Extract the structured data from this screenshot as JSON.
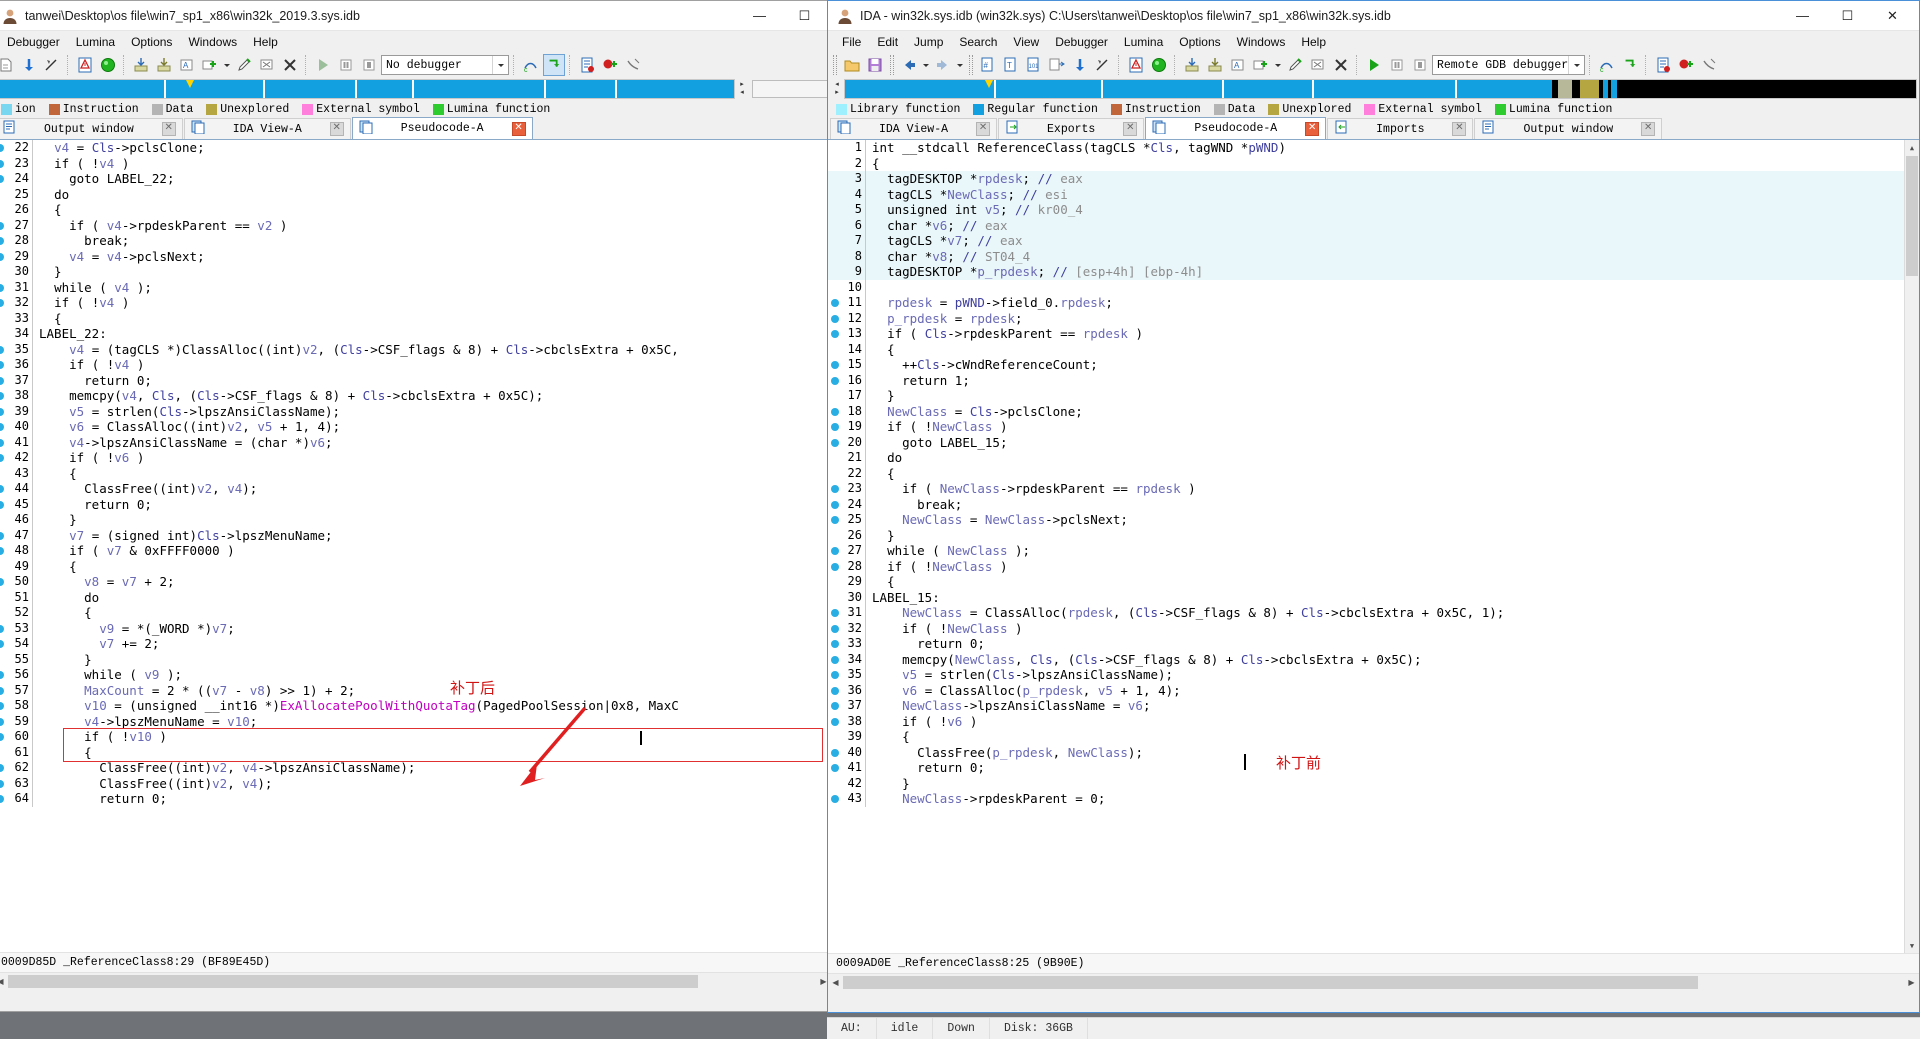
{
  "left_window": {
    "title": "tanwei\\Desktop\\os file\\win7_sp1_x86\\win32k_2019.3.sys.idb",
    "controls": {
      "minimize": "—",
      "maximize": "☐",
      "close": "✕"
    },
    "menu": [
      "Debugger",
      "Lumina",
      "Options",
      "Windows",
      "Help"
    ],
    "toolbar": {
      "debugger_combo": "No debugger"
    },
    "legend": [
      {
        "label": "ion",
        "color": "#7ad7f0"
      },
      {
        "label": "Instruction",
        "color": "#c1663a"
      },
      {
        "label": "Data",
        "color": "#b4b4b4"
      },
      {
        "label": "Unexplored",
        "color": "#b5a642"
      },
      {
        "label": "External symbol",
        "color": "#ff7fdc"
      },
      {
        "label": "Lumina function",
        "color": "#2ecc2e"
      }
    ],
    "tabs": [
      {
        "label": "Output window",
        "active": false
      },
      {
        "label": "IDA View-A",
        "active": false
      },
      {
        "label": "Pseudocode-A",
        "active": true
      }
    ],
    "annotation": "补丁后",
    "address_status": "0009D85D _ReferenceClass8:29 (BF89E45D)",
    "code": [
      {
        "n": "22",
        "bp": true,
        "indent": 1,
        "text": "v4 = Cls->pclsClone;"
      },
      {
        "n": "23",
        "bp": true,
        "indent": 1,
        "text": "if ( !v4 )"
      },
      {
        "n": "24",
        "bp": true,
        "indent": 2,
        "text": "goto LABEL_22;"
      },
      {
        "n": "25",
        "bp": false,
        "indent": 1,
        "text": "do"
      },
      {
        "n": "26",
        "bp": false,
        "indent": 1,
        "text": "{"
      },
      {
        "n": "27",
        "bp": true,
        "indent": 2,
        "text": "if ( v4->rpdeskParent == v2 )"
      },
      {
        "n": "28",
        "bp": true,
        "indent": 3,
        "text": "break;"
      },
      {
        "n": "29",
        "bp": true,
        "indent": 2,
        "text": "v4 = v4->pclsNext;"
      },
      {
        "n": "30",
        "bp": false,
        "indent": 1,
        "text": "}"
      },
      {
        "n": "31",
        "bp": true,
        "indent": 1,
        "text": "while ( v4 );"
      },
      {
        "n": "32",
        "bp": true,
        "indent": 1,
        "text": "if ( !v4 )"
      },
      {
        "n": "33",
        "bp": false,
        "indent": 1,
        "text": "{"
      },
      {
        "n": "34",
        "bp": false,
        "indent": 0,
        "text": "LABEL_22:"
      },
      {
        "n": "35",
        "bp": true,
        "indent": 2,
        "text": "v4 = (tagCLS *)ClassAlloc((int)v2, (Cls->CSF_flags & 8) + Cls->cbclsExtra + 0x5C,"
      },
      {
        "n": "36",
        "bp": true,
        "indent": 2,
        "text": "if ( !v4 )"
      },
      {
        "n": "37",
        "bp": true,
        "indent": 3,
        "text": "return 0;"
      },
      {
        "n": "38",
        "bp": true,
        "indent": 2,
        "text": "memcpy(v4, Cls, (Cls->CSF_flags & 8) + Cls->cbclsExtra + 0x5C);"
      },
      {
        "n": "39",
        "bp": true,
        "indent": 2,
        "text": "v5 = strlen(Cls->lpszAnsiClassName);"
      },
      {
        "n": "40",
        "bp": true,
        "indent": 2,
        "text": "v6 = ClassAlloc((int)v2, v5 + 1, 4);"
      },
      {
        "n": "41",
        "bp": true,
        "indent": 2,
        "text": "v4->lpszAnsiClassName = (char *)v6;"
      },
      {
        "n": "42",
        "bp": true,
        "indent": 2,
        "text": "if ( !v6 )"
      },
      {
        "n": "43",
        "bp": false,
        "indent": 2,
        "text": "{"
      },
      {
        "n": "44",
        "bp": true,
        "indent": 3,
        "text": "ClassFree((int)v2, v4);"
      },
      {
        "n": "45",
        "bp": true,
        "indent": 3,
        "text": "return 0;"
      },
      {
        "n": "46",
        "bp": false,
        "indent": 2,
        "text": "}"
      },
      {
        "n": "47",
        "bp": true,
        "indent": 2,
        "text": "v7 = (signed int)Cls->lpszMenuName;"
      },
      {
        "n": "48",
        "bp": true,
        "indent": 2,
        "text": "if ( v7 & 0xFFFF0000 )"
      },
      {
        "n": "49",
        "bp": false,
        "indent": 2,
        "text": "{"
      },
      {
        "n": "50",
        "bp": true,
        "indent": 3,
        "text": "v8 = v7 + 2;"
      },
      {
        "n": "51",
        "bp": false,
        "indent": 3,
        "text": "do"
      },
      {
        "n": "52",
        "bp": false,
        "indent": 3,
        "text": "{"
      },
      {
        "n": "53",
        "bp": true,
        "indent": 4,
        "text": "v9 = *(_WORD *)v7;"
      },
      {
        "n": "54",
        "bp": true,
        "indent": 4,
        "text": "v7 += 2;"
      },
      {
        "n": "55",
        "bp": false,
        "indent": 3,
        "text": "}"
      },
      {
        "n": "56",
        "bp": true,
        "indent": 3,
        "text": "while ( v9 );"
      },
      {
        "n": "57",
        "bp": true,
        "indent": 3,
        "text": "MaxCount = 2 * ((v7 - v8) >> 1) + 2;"
      },
      {
        "n": "58",
        "bp": true,
        "indent": 3,
        "text": "v10 = (unsigned __int16 *)ExAllocatePoolWithQuotaTag(PagedPoolSession|0x8, MaxC"
      },
      {
        "n": "59",
        "bp": true,
        "indent": 3,
        "text": "v4->lpszMenuName = v10;"
      },
      {
        "n": "60",
        "bp": true,
        "indent": 3,
        "text": "if ( !v10 )"
      },
      {
        "n": "61",
        "bp": false,
        "indent": 3,
        "text": "{"
      },
      {
        "n": "62",
        "bp": true,
        "indent": 4,
        "text": "ClassFree((int)v2, v4->lpszAnsiClassName);"
      },
      {
        "n": "63",
        "bp": true,
        "indent": 4,
        "text": "ClassFree((int)v2, v4);"
      },
      {
        "n": "64",
        "bp": true,
        "indent": 4,
        "text": "return 0;"
      }
    ]
  },
  "right_window": {
    "title": "IDA - win32k.sys.idb (win32k.sys) C:\\Users\\tanwei\\Desktop\\os file\\win7_sp1_x86\\win32k.sys.idb",
    "controls": {
      "minimize": "—",
      "maximize": "☐",
      "close": "✕"
    },
    "menu": [
      "File",
      "Edit",
      "Jump",
      "Search",
      "View",
      "Debugger",
      "Lumina",
      "Options",
      "Windows",
      "Help"
    ],
    "toolbar": {
      "debugger_combo": "Remote GDB debugger"
    },
    "legend": [
      {
        "label": "Library function",
        "color": "#9ff0ff"
      },
      {
        "label": "Regular function",
        "color": "#13a0e0"
      },
      {
        "label": "Instruction",
        "color": "#c1663a"
      },
      {
        "label": "Data",
        "color": "#b4b4b4"
      },
      {
        "label": "Unexplored",
        "color": "#b5a642"
      },
      {
        "label": "External symbol",
        "color": "#ff7fdc"
      },
      {
        "label": "Lumina function",
        "color": "#2ecc2e"
      }
    ],
    "tabs": [
      {
        "label": "IDA View-A",
        "active": false
      },
      {
        "label": "Exports",
        "active": false
      },
      {
        "label": "Pseudocode-A",
        "active": true
      },
      {
        "label": "Imports",
        "active": false
      },
      {
        "label": "Output window",
        "active": false
      }
    ],
    "annotation": "补丁前",
    "address_status": "0009AD0E _ReferenceClass8:25 (9B90E)",
    "statusbar": [
      "AU:",
      "idle",
      "Down",
      "Disk: 36GB"
    ],
    "code": [
      {
        "n": "1",
        "bp": false,
        "indent": 0,
        "hl": false,
        "text": "int __stdcall ReferenceClass(tagCLS *Cls, tagWND *pWND)"
      },
      {
        "n": "2",
        "bp": false,
        "indent": 0,
        "hl": false,
        "text": "{"
      },
      {
        "n": "3",
        "bp": false,
        "indent": 1,
        "hl": true,
        "text": "tagDESKTOP *rpdesk; // eax"
      },
      {
        "n": "4",
        "bp": false,
        "indent": 1,
        "hl": true,
        "text": "tagCLS *NewClass; // esi"
      },
      {
        "n": "5",
        "bp": false,
        "indent": 1,
        "hl": true,
        "text": "unsigned int v5; // kr00_4"
      },
      {
        "n": "6",
        "bp": false,
        "indent": 1,
        "hl": true,
        "text": "char *v6; // eax"
      },
      {
        "n": "7",
        "bp": false,
        "indent": 1,
        "hl": true,
        "text": "tagCLS *v7; // eax"
      },
      {
        "n": "8",
        "bp": false,
        "indent": 1,
        "hl": true,
        "text": "char *v8; // ST04_4"
      },
      {
        "n": "9",
        "bp": false,
        "indent": 1,
        "hl": true,
        "text": "tagDESKTOP *p_rpdesk; // [esp+4h] [ebp-4h]"
      },
      {
        "n": "10",
        "bp": false,
        "indent": 0,
        "hl": false,
        "text": ""
      },
      {
        "n": "11",
        "bp": true,
        "indent": 1,
        "hl": false,
        "text": "rpdesk = pWND->field_0.rpdesk;"
      },
      {
        "n": "12",
        "bp": true,
        "indent": 1,
        "hl": false,
        "text": "p_rpdesk = rpdesk;"
      },
      {
        "n": "13",
        "bp": true,
        "indent": 1,
        "hl": false,
        "text": "if ( Cls->rpdeskParent == rpdesk )"
      },
      {
        "n": "14",
        "bp": false,
        "indent": 1,
        "hl": false,
        "text": "{"
      },
      {
        "n": "15",
        "bp": true,
        "indent": 2,
        "hl": false,
        "text": "++Cls->cWndReferenceCount;"
      },
      {
        "n": "16",
        "bp": true,
        "indent": 2,
        "hl": false,
        "text": "return 1;"
      },
      {
        "n": "17",
        "bp": false,
        "indent": 1,
        "hl": false,
        "text": "}"
      },
      {
        "n": "18",
        "bp": true,
        "indent": 1,
        "hl": false,
        "text": "NewClass = Cls->pclsClone;"
      },
      {
        "n": "19",
        "bp": true,
        "indent": 1,
        "hl": false,
        "text": "if ( !NewClass )"
      },
      {
        "n": "20",
        "bp": true,
        "indent": 2,
        "hl": false,
        "text": "goto LABEL_15;"
      },
      {
        "n": "21",
        "bp": false,
        "indent": 1,
        "hl": false,
        "text": "do"
      },
      {
        "n": "22",
        "bp": false,
        "indent": 1,
        "hl": false,
        "text": "{"
      },
      {
        "n": "23",
        "bp": true,
        "indent": 2,
        "hl": false,
        "text": "if ( NewClass->rpdeskParent == rpdesk )"
      },
      {
        "n": "24",
        "bp": true,
        "indent": 3,
        "hl": false,
        "text": "break;"
      },
      {
        "n": "25",
        "bp": true,
        "indent": 2,
        "hl": false,
        "text": "NewClass = NewClass->pclsNext;"
      },
      {
        "n": "26",
        "bp": false,
        "indent": 1,
        "hl": false,
        "text": "}"
      },
      {
        "n": "27",
        "bp": true,
        "indent": 1,
        "hl": false,
        "text": "while ( NewClass );"
      },
      {
        "n": "28",
        "bp": true,
        "indent": 1,
        "hl": false,
        "text": "if ( !NewClass )"
      },
      {
        "n": "29",
        "bp": false,
        "indent": 1,
        "hl": false,
        "text": "{"
      },
      {
        "n": "30",
        "bp": false,
        "indent": 0,
        "hl": false,
        "text": "LABEL_15:"
      },
      {
        "n": "31",
        "bp": true,
        "indent": 2,
        "hl": false,
        "text": "NewClass = ClassAlloc(rpdesk, (Cls->CSF_flags & 8) + Cls->cbclsExtra + 0x5C, 1);"
      },
      {
        "n": "32",
        "bp": true,
        "indent": 2,
        "hl": false,
        "text": "if ( !NewClass )"
      },
      {
        "n": "33",
        "bp": true,
        "indent": 3,
        "hl": false,
        "text": "return 0;"
      },
      {
        "n": "34",
        "bp": true,
        "indent": 2,
        "hl": false,
        "text": "memcpy(NewClass, Cls, (Cls->CSF_flags & 8) + Cls->cbclsExtra + 0x5C);"
      },
      {
        "n": "35",
        "bp": true,
        "indent": 2,
        "hl": false,
        "text": "v5 = strlen(Cls->lpszAnsiClassName);"
      },
      {
        "n": "36",
        "bp": true,
        "indent": 2,
        "hl": false,
        "text": "v6 = ClassAlloc(p_rpdesk, v5 + 1, 4);"
      },
      {
        "n": "37",
        "bp": true,
        "indent": 2,
        "hl": false,
        "text": "NewClass->lpszAnsiClassName = v6;"
      },
      {
        "n": "38",
        "bp": true,
        "indent": 2,
        "hl": false,
        "text": "if ( !v6 )"
      },
      {
        "n": "39",
        "bp": false,
        "indent": 2,
        "hl": false,
        "text": "{"
      },
      {
        "n": "40",
        "bp": true,
        "indent": 3,
        "hl": false,
        "text": "ClassFree(p_rpdesk, NewClass);"
      },
      {
        "n": "41",
        "bp": true,
        "indent": 3,
        "hl": false,
        "text": "return 0;"
      },
      {
        "n": "42",
        "bp": false,
        "indent": 2,
        "hl": false,
        "text": "}"
      },
      {
        "n": "43",
        "bp": true,
        "indent": 2,
        "hl": false,
        "text": "NewClass->rpdeskParent = 0;"
      }
    ]
  },
  "colors": {
    "accent_blue": "#13a0e0",
    "highlight_row": "#eaf7fa",
    "annotation_red": "#d01414",
    "imported_api": "#c000c0"
  }
}
